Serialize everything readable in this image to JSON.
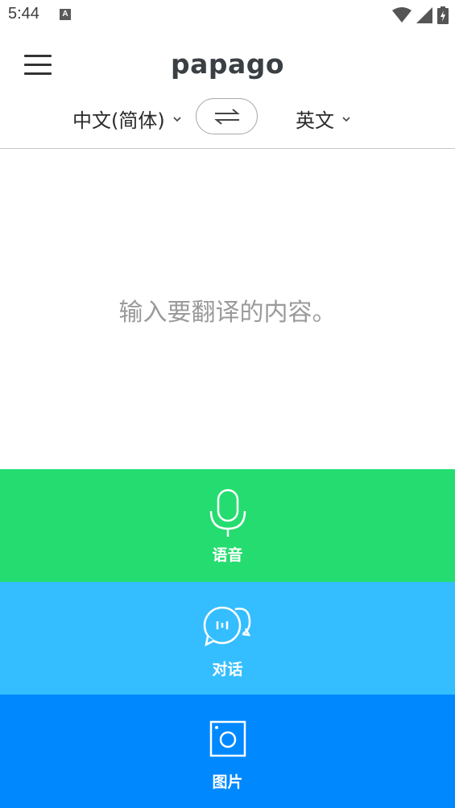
{
  "status_bar": {
    "time": "5:44",
    "notification_icon": "A"
  },
  "app": {
    "logo": "papago"
  },
  "languages": {
    "source": "中文(简体)",
    "target": "英文"
  },
  "input": {
    "placeholder": "输入要翻译的内容。"
  },
  "actions": [
    {
      "label": "语音",
      "icon": "microphone-icon",
      "color": "#25dc70"
    },
    {
      "label": "对话",
      "icon": "chat-bubbles-icon",
      "color": "#35beff"
    },
    {
      "label": "图片",
      "icon": "camera-icon",
      "color": "#0089ff"
    }
  ]
}
